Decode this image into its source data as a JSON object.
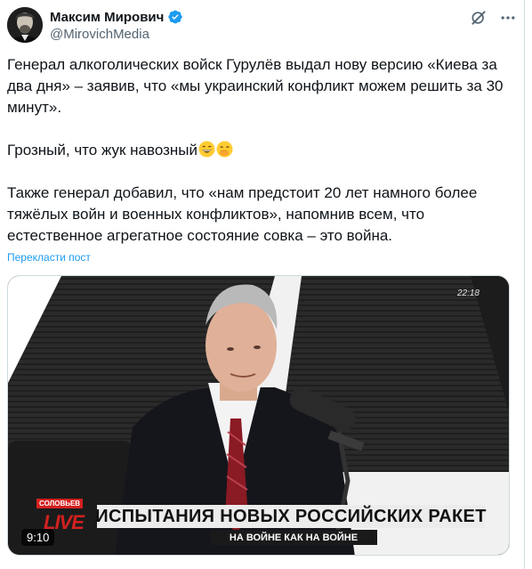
{
  "author": {
    "name": "Максим Мирович",
    "handle": "@MirovichMedia",
    "avatar_icon": "portrait-avatar",
    "verified_icon": "verified-badge-icon",
    "verified_color": "#1d9bf0"
  },
  "post": {
    "paragraph1": "Генерал алкоголических войск Гурулёв выдал нову версию «Киева за два дня» – заявив, что «мы украинский конфликт можем решить за 30 минут».",
    "paragraph2": "Грозный, что жук навозный",
    "paragraph2_emojis": [
      "grinning-face-emoji",
      "face-with-hand-over-mouth-emoji"
    ],
    "paragraph3": "Также генерал добавил, что «нам предстоит 20 лет намного более тяжёлых войн и военных конфликтов», напомнив всем, что естественное агрегатное состояние совка – это война.",
    "translate_label": "Перекласти пост",
    "link_color": "#1d9bf0"
  },
  "video": {
    "timecode": "22:18",
    "duration": "9:10",
    "banner_title": "ИСПЫТАНИЯ НОВЫХ РОССИЙСКИХ РАКЕТ",
    "banner_subtitle": "НА ВОЙНЕ КАК НА ВОЙНЕ",
    "channel_label": "СОЛОВЬЕВ",
    "live_label": "LIVE"
  },
  "actions": {
    "grok_icon": "grok-icon",
    "more_icon": "more-options-icon"
  }
}
